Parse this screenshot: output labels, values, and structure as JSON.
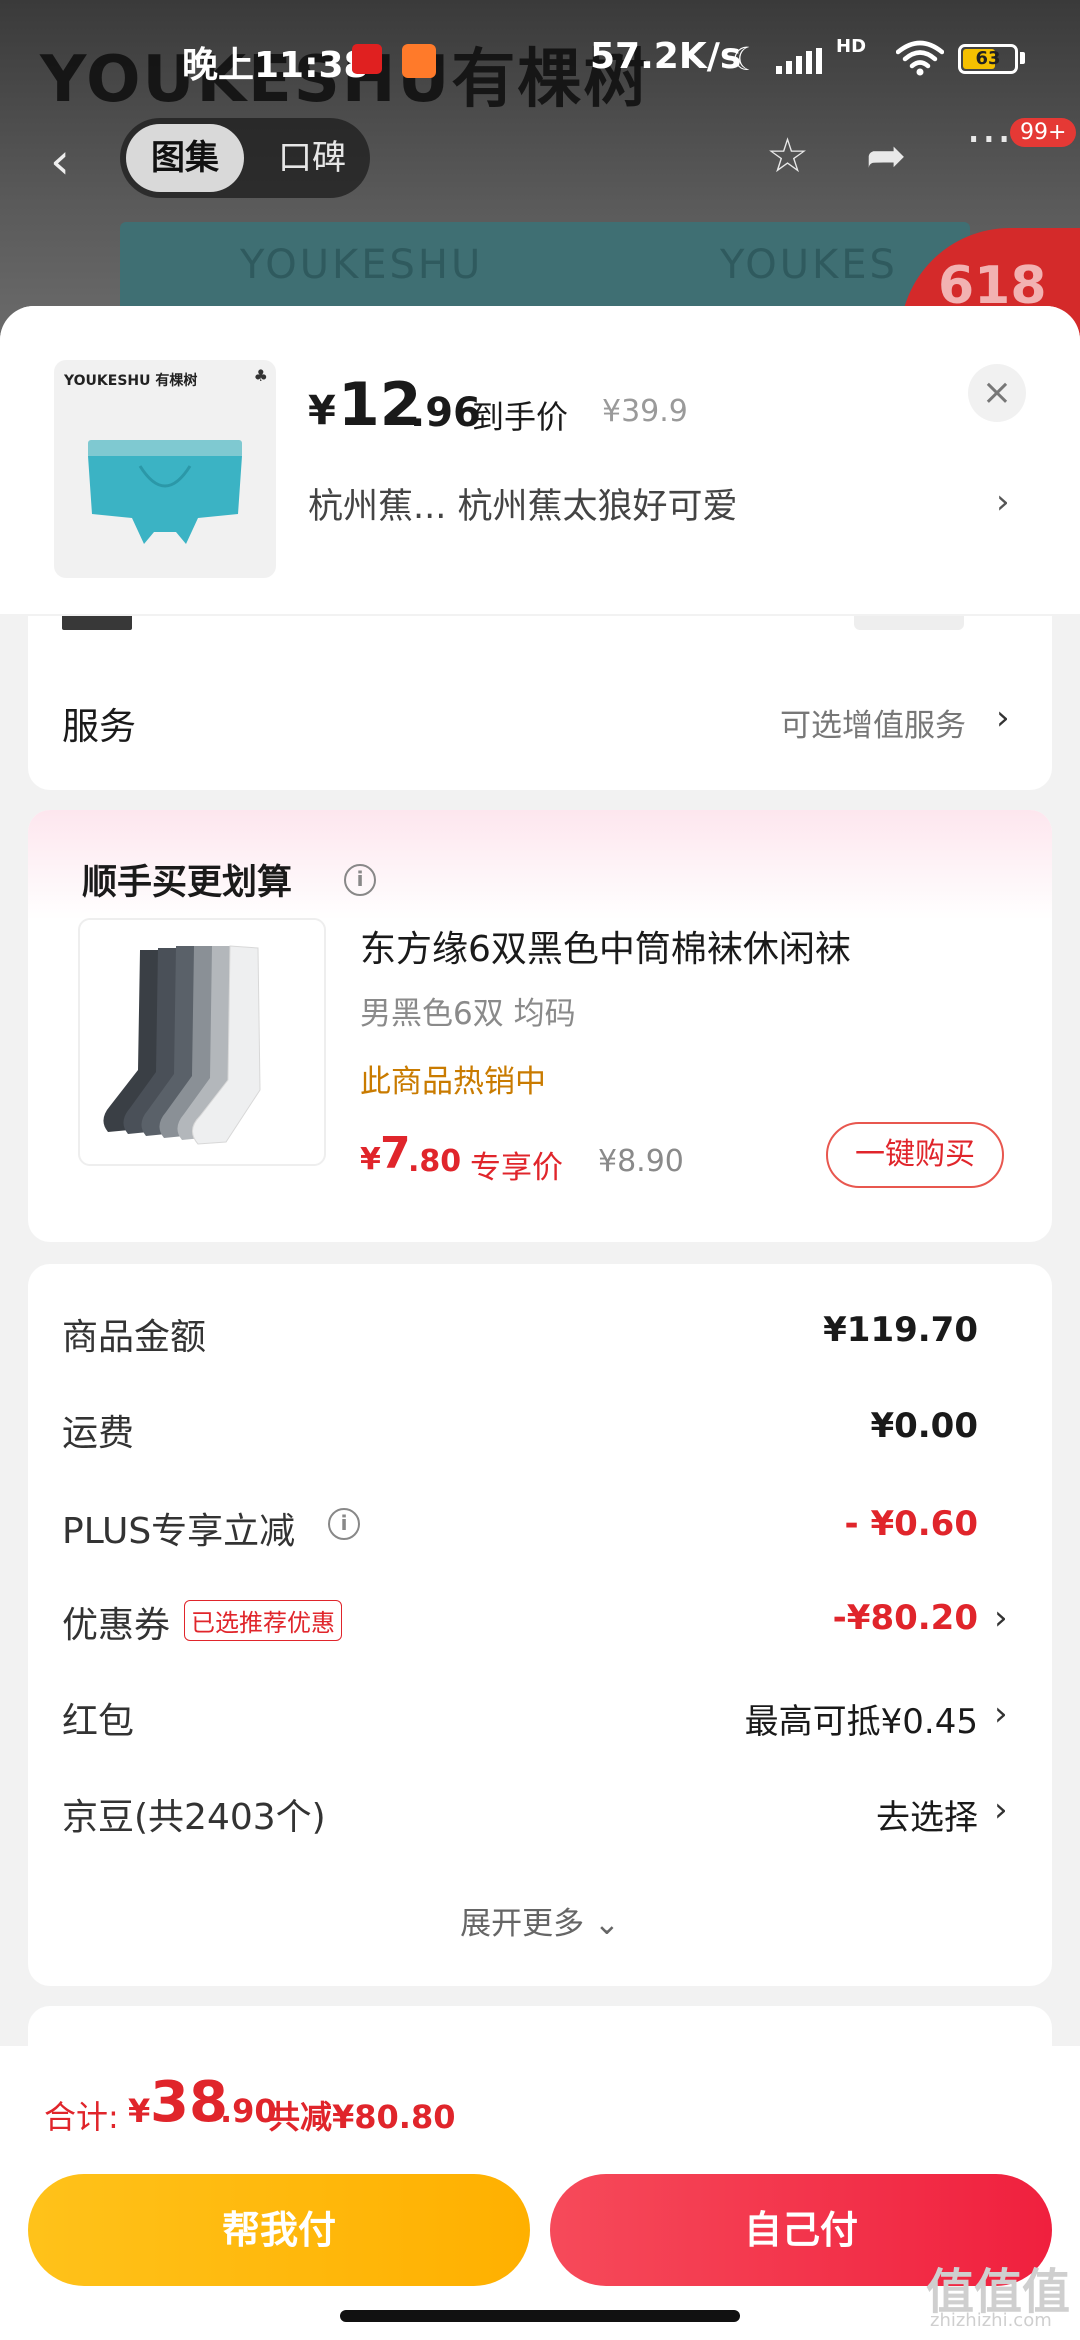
{
  "status_bar": {
    "time": "晚上11:38",
    "net_speed": "57.2K/s",
    "hd": "HD",
    "battery": "63",
    "battery_fraction": 0.63
  },
  "background": {
    "brand": "YOUKESHU有棵树",
    "box_text_1": "YOUKESHU",
    "box_text_2": "YOUKES",
    "promo_badge": "618",
    "tabs": [
      "图集",
      "口碑"
    ],
    "notif_badge": "99+"
  },
  "sheet_header": {
    "thumb_brand": "YOUKESHU 有棵树",
    "price_symbol": "¥",
    "price_int": "12",
    "price_dec": ".96",
    "price_tag": "到手价",
    "original_price": "¥39.9",
    "spec_text": "杭州蕉...  杭州蕉太狼好可爱",
    "close_icon": "×"
  },
  "services": {
    "label": "服务",
    "value": "可选增值服务"
  },
  "bundle": {
    "title": "顺手买更划算",
    "product_name": "东方缘6双黑色中筒棉袜休闲袜",
    "spec": "男黑色6双    均码",
    "hot_text": "此商品热销中",
    "price_symbol": "¥",
    "price_int": "7",
    "price_dec": ".80",
    "price_tag": "专享价",
    "original_price": "¥8.90",
    "buy_button": "一键购买"
  },
  "summary": {
    "rows": [
      {
        "label": "商品金额",
        "value": "¥119.70"
      },
      {
        "label": "运费",
        "value": "¥0.00"
      },
      {
        "label": "PLUS专享立减",
        "value": "- ¥0.60"
      },
      {
        "label": "优惠券",
        "tag": "已选推荐优惠",
        "value": "-¥80.20"
      },
      {
        "label": "红包",
        "value": "最高可抵¥0.45"
      },
      {
        "label": "京豆(共2403个)",
        "value": "去选择"
      }
    ],
    "expand": "展开更多 ⌄"
  },
  "bottom": {
    "total_label": "合计:",
    "total_symbol": "¥",
    "total_int": "38",
    "total_dec": ".90",
    "total_save": "共减¥80.80",
    "help_pay": "帮我付",
    "self_pay": "自己付"
  },
  "watermark": {
    "main": "值值值",
    "sub": "zhizhizhi.com"
  },
  "colors": {
    "accent_red": "#e0252b",
    "yellow_button": "#ffb000",
    "red_button": "#f0203e",
    "hot_orange": "#c97b00"
  }
}
